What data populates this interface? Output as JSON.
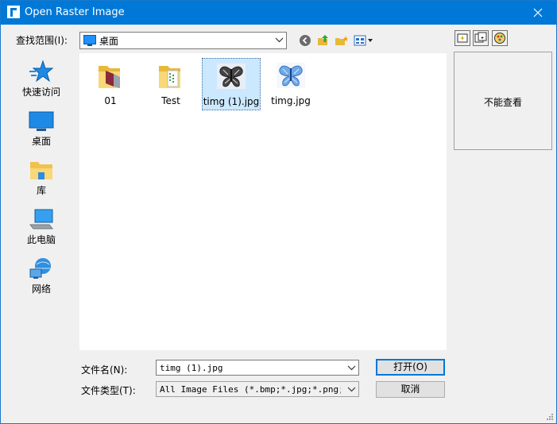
{
  "window": {
    "title": "Open Raster Image",
    "colors": {
      "titlebar": "#0078d7",
      "selection": "#cce8ff",
      "face": "#f0f0f0"
    }
  },
  "lookin": {
    "label": "查找范围(I):",
    "value": "桌面",
    "icon": "desktop-icon"
  },
  "toolbar": {
    "buttons": [
      "back-icon",
      "up-folder-icon",
      "new-folder-icon",
      "view-menu-icon"
    ]
  },
  "places": [
    {
      "label": "快速访问",
      "icon": "star-icon"
    },
    {
      "label": "桌面",
      "icon": "desktop-icon"
    },
    {
      "label": "库",
      "icon": "library-icon"
    },
    {
      "label": "此电脑",
      "icon": "computer-icon"
    },
    {
      "label": "网络",
      "icon": "network-icon"
    }
  ],
  "files": [
    {
      "name": "01",
      "icon": "folder-icon",
      "selected": false
    },
    {
      "name": "Test",
      "icon": "folder-icon",
      "selected": false
    },
    {
      "name": "timg (1).jpg",
      "icon": "butterfly-image-icon",
      "selected": true
    },
    {
      "name": "timg.jpg",
      "icon": "butterfly-image-icon",
      "selected": false
    }
  ],
  "preview": {
    "message": "不能查看",
    "tools": [
      "preview-fit-icon",
      "preview-zoom-icon",
      "preview-color-icon"
    ]
  },
  "form": {
    "filename_label": "文件名(N):",
    "filename_value": "timg (1).jpg",
    "filetype_label": "文件类型(T):",
    "filetype_value": "All Image Files (*.bmp;*.jpg;*.png;*.ti",
    "open_label": "打开(O)",
    "cancel_label": "取消"
  }
}
